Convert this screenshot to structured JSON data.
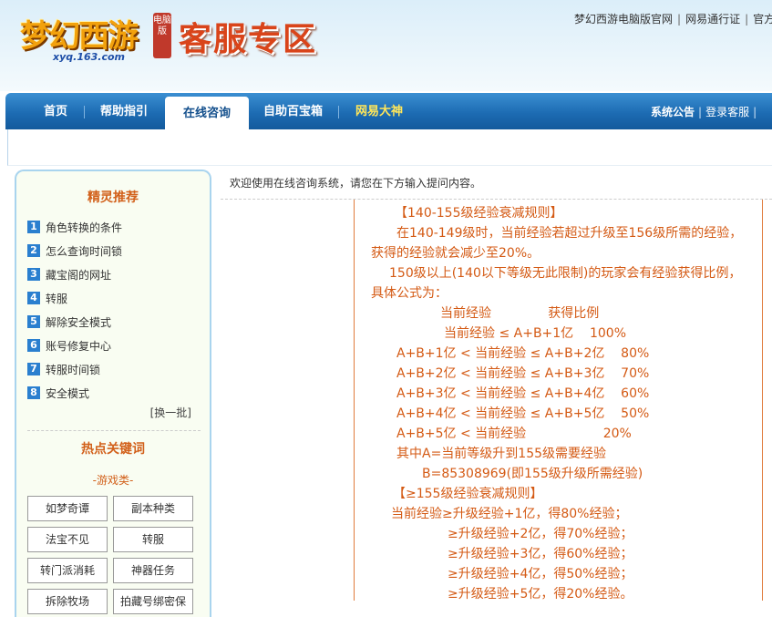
{
  "header": {
    "logo_text": "梦幻西游",
    "logo_badge": "电脑版",
    "logo_url": "xyq.163.com",
    "site_title": "客服专区",
    "top_links": [
      "梦幻西游电脑版官网",
      "网易通行证",
      "官方"
    ]
  },
  "nav": {
    "items": [
      "首页",
      "帮助指引",
      "在线咨询",
      "自助百宝箱",
      "网易大神"
    ],
    "active_index": 2,
    "right_links": [
      "系统公告",
      "登录客服"
    ]
  },
  "sidebar": {
    "recommend_title": "精灵推荐",
    "recommend_items": [
      "角色转换的条件",
      "怎么查询时间锁",
      "藏宝阁的网址",
      "转服",
      "解除安全模式",
      "账号修复中心",
      "转服时间锁",
      "安全模式"
    ],
    "more_batch": "[换一批]",
    "hot_title": "热点关键词",
    "game_category": "-游戏类-",
    "keywords": [
      "如梦奇谭",
      "副本种类",
      "法宝不见",
      "转服",
      "转门派消耗",
      "神器任务",
      "拆除牧场",
      "拍藏号绑密保"
    ]
  },
  "main": {
    "welcome": "欢迎使用在线咨询系统，请您在下方输入提问内容。",
    "article_lines": [
      "【140-155级经验衰减规则】",
      "在140-149级时，当前经验若超过升级至156级所需的经验，",
      "获得的经验就会减少至20%。",
      "150级以上(140以下等级无此限制)的玩家会有经验获得比例，",
      "具体公式为：",
      "当前经验              获得比例",
      "当前经验 ≤ A+B+1亿    100%",
      "A+B+1亿 < 当前经验 ≤ A+B+2亿    80%",
      "A+B+2亿 < 当前经验 ≤ A+B+3亿    70%",
      "A+B+3亿 < 当前经验 ≤ A+B+4亿    60%",
      "A+B+4亿 < 当前经验 ≤ A+B+5亿    50%",
      "A+B+5亿 < 当前经验                   20%",
      "其中A=当前等级升到155级需要经验",
      "B=85308969(即155级升级所需经验)",
      "【≥155级经验衰减规则】",
      "当前经验≥升级经验+1亿，得80%经验；",
      "≥升级经验+2亿，得70%经验；",
      "≥升级经验+3亿，得60%经验；",
      "≥升级经验+4亿，得50%经验；",
      "≥升级经验+5亿，得20%经验。"
    ]
  },
  "colors": {
    "nav_blue": "#1d6cb3",
    "accent_orange": "#d45a14",
    "title_red": "#d9441a"
  }
}
